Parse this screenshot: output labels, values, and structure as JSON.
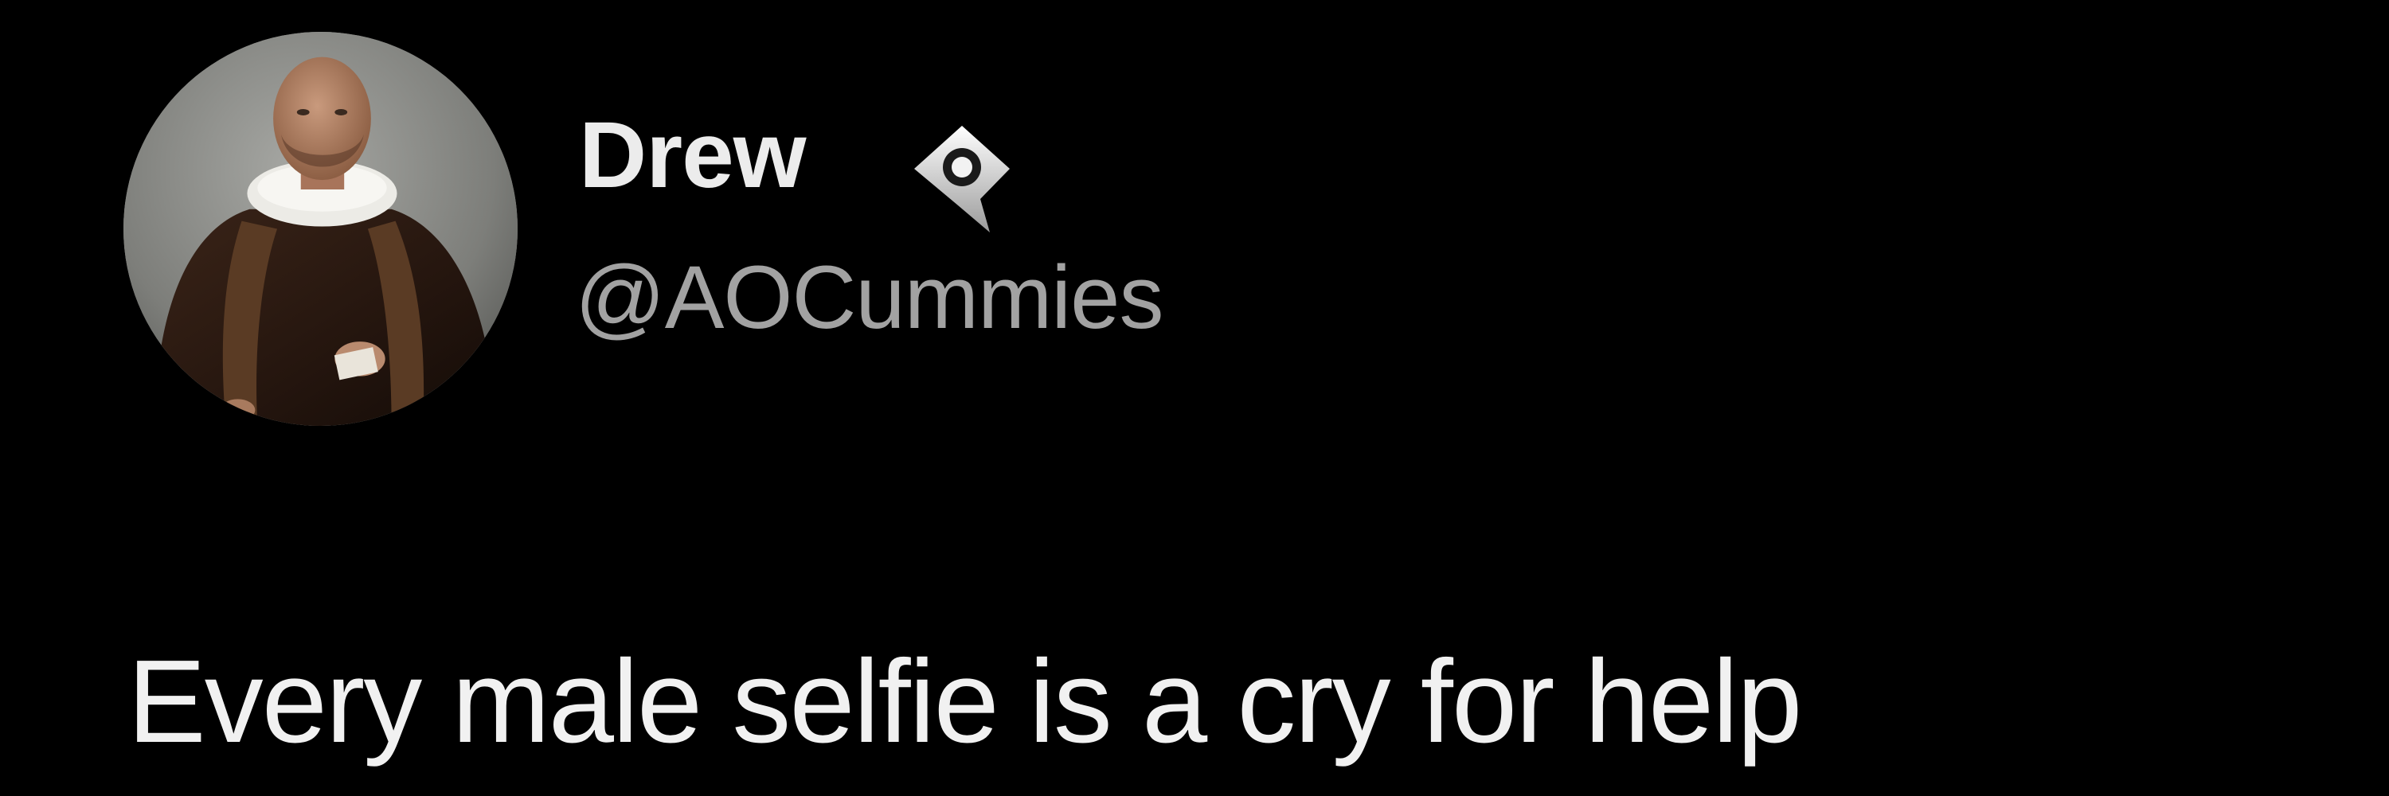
{
  "tweet": {
    "author": {
      "display_name": "Drew",
      "handle": "@AOCummies",
      "avatar_icon": "portrait-avatar",
      "badge_icon": "eye-speech-bubble-badge-icon"
    },
    "text": "Every male selfie is a cry for help"
  },
  "colors": {
    "background": "#000000",
    "display_name": "#ececec",
    "handle": "#a2a2a2",
    "text": "#f1f1f1"
  }
}
